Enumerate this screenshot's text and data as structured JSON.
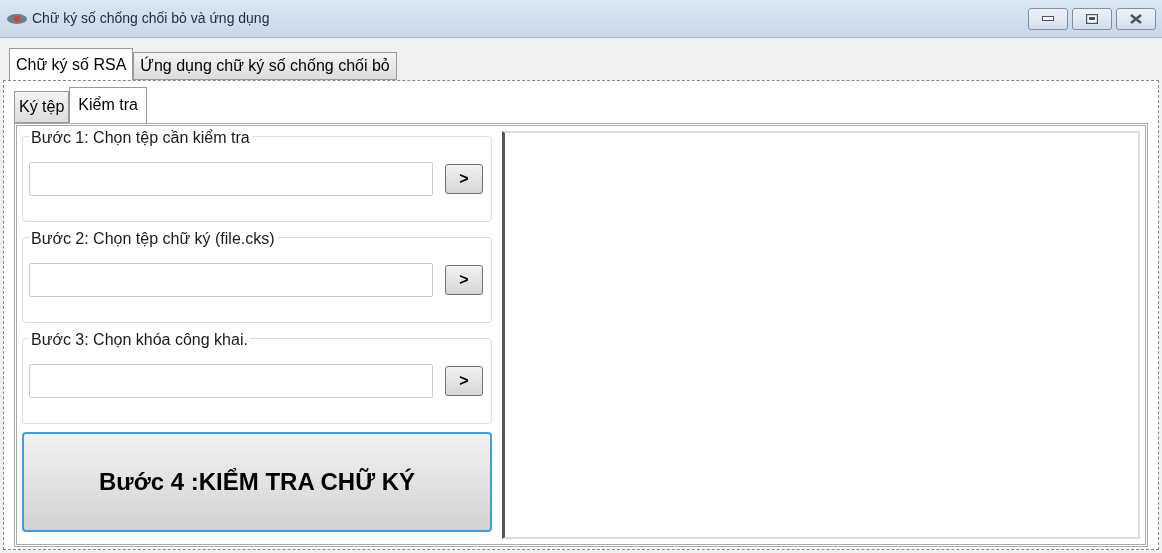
{
  "window": {
    "title": "Chữ ký số chống chối bỏ và ứng dụng"
  },
  "tabs": [
    {
      "label": "Chữ ký số RSA",
      "selected": true
    },
    {
      "label": "Ứng dụng chữ ký số chống chối bỏ",
      "selected": false
    }
  ],
  "sub_tabs": [
    {
      "label": "Ký tệp",
      "selected": false
    },
    {
      "label": "Kiểm tra",
      "selected": true
    }
  ],
  "steps": [
    {
      "label": "Bước 1: Chọn tệp cần kiểm tra",
      "browse": ">"
    },
    {
      "label": "Bước 2: Chọn tệp chữ ký (file.cks)",
      "browse": ">"
    },
    {
      "label": "Bước 3: Chọn khóa công khai.",
      "browse": ">"
    }
  ],
  "verify_button": "Bước 4 :KIỂM TRA CHỮ KÝ"
}
